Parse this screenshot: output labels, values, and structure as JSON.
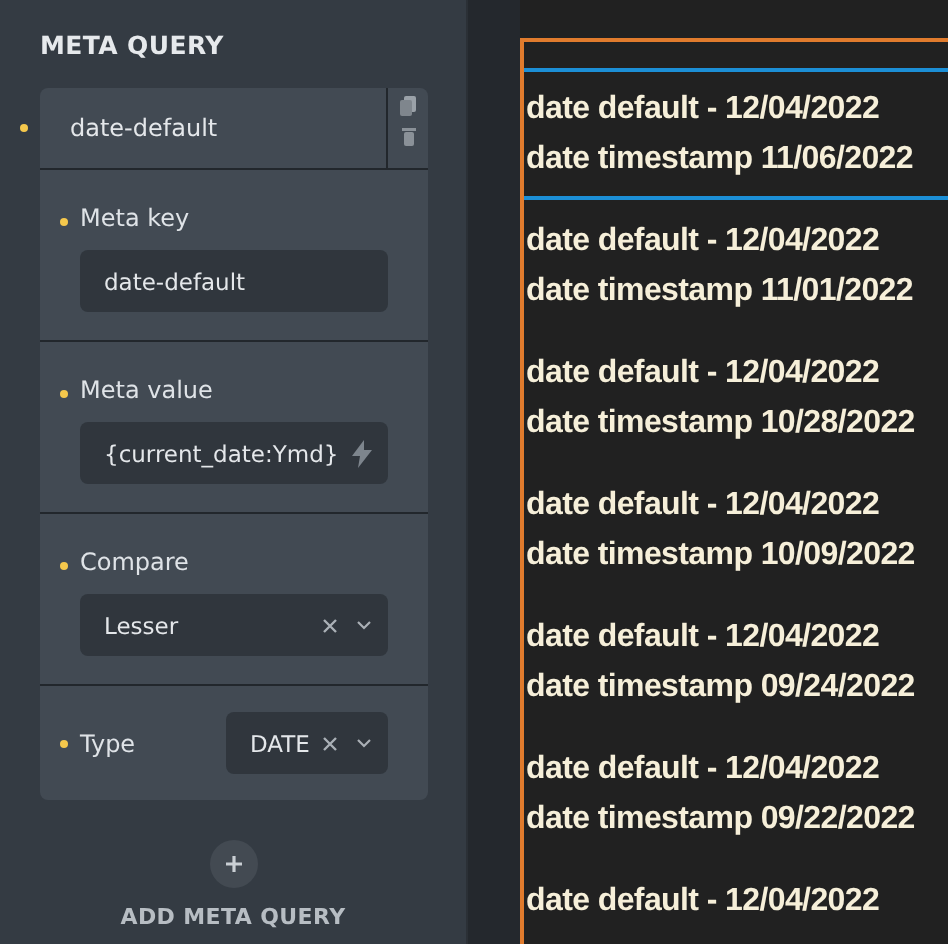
{
  "panel": {
    "title": "META QUERY",
    "query": {
      "name": "date-default",
      "fields": [
        {
          "kind": "text",
          "label": "Meta key",
          "value": "date-default"
        },
        {
          "kind": "dynamic",
          "label": "Meta value",
          "value": "{current_date:Ymd}"
        },
        {
          "kind": "select",
          "label": "Compare",
          "value": "Lesser"
        },
        {
          "kind": "inline_select",
          "label": "Type",
          "value": "DATE"
        }
      ]
    },
    "add_button": "ADD META QUERY"
  },
  "canvas": {
    "posts": [
      {
        "line_1": "date default - 12/04/2022",
        "line_2": "date timestamp 11/06/2022",
        "selected": true
      },
      {
        "line_1": "date default - 12/04/2022",
        "line_2": "date timestamp 11/01/2022",
        "selected": false
      },
      {
        "line_1": "date default - 12/04/2022",
        "line_2": "date timestamp 10/28/2022",
        "selected": false
      },
      {
        "line_1": "date default - 12/04/2022",
        "line_2": "date timestamp 10/09/2022",
        "selected": false
      },
      {
        "line_1": "date default - 12/04/2022",
        "line_2": "date timestamp 09/24/2022",
        "selected": false
      },
      {
        "line_1": "date default - 12/04/2022",
        "line_2": "date timestamp 09/22/2022",
        "selected": false
      },
      {
        "line_1": "date default - 12/04/2022",
        "selected": false
      }
    ]
  }
}
